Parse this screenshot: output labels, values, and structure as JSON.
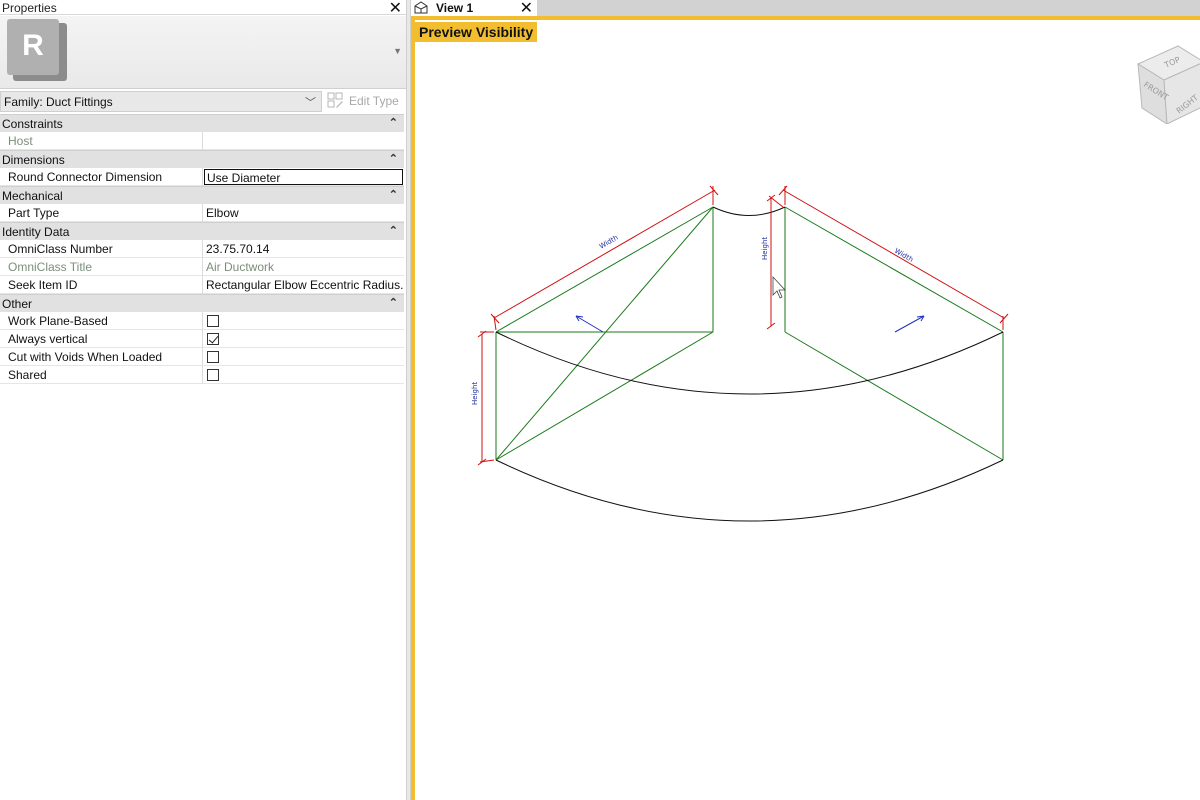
{
  "properties": {
    "title": "Properties",
    "close_symbol": "✕",
    "logo_letter": "R",
    "family_selector": "Family: Duct Fittings",
    "edit_type_label": "Edit Type",
    "categories": [
      {
        "name": "Constraints",
        "rows": [
          {
            "name": "Host",
            "value": "",
            "dim": true
          }
        ]
      },
      {
        "name": "Dimensions",
        "rows": [
          {
            "name": "Round Connector Dimension",
            "value": "Use Diameter",
            "editing": true
          }
        ]
      },
      {
        "name": "Mechanical",
        "rows": [
          {
            "name": "Part Type",
            "value": "Elbow"
          }
        ]
      },
      {
        "name": "Identity Data",
        "rows": [
          {
            "name": "OmniClass Number",
            "value": "23.75.70.14"
          },
          {
            "name": "OmniClass Title",
            "value": "Air Ductwork",
            "dim": true
          },
          {
            "name": "Seek Item ID",
            "value": "Rectangular Elbow Eccentric Radius..."
          }
        ]
      },
      {
        "name": "Other",
        "rows": [
          {
            "name": "Work Plane-Based",
            "checkbox": false
          },
          {
            "name": "Always vertical",
            "checkbox": true
          },
          {
            "name": "Cut with Voids When Loaded",
            "checkbox": false
          },
          {
            "name": "Shared",
            "checkbox": false
          }
        ]
      }
    ]
  },
  "view": {
    "tab_label": "View 1",
    "tab_close": "✕",
    "preview_label": "Preview Visibility",
    "dimension_labels": {
      "width_left": "Width",
      "width_right": "Width",
      "height_left": "Height",
      "height_right": "Height"
    },
    "viewcube": {
      "top": "TOP",
      "front": "FRONT",
      "right": "RIGHT"
    }
  },
  "colors": {
    "accent": "#f2bd2f",
    "model_lines": "#1a7a1a",
    "dimensions": "#d01010",
    "flow_arrows": "#2030c0"
  }
}
